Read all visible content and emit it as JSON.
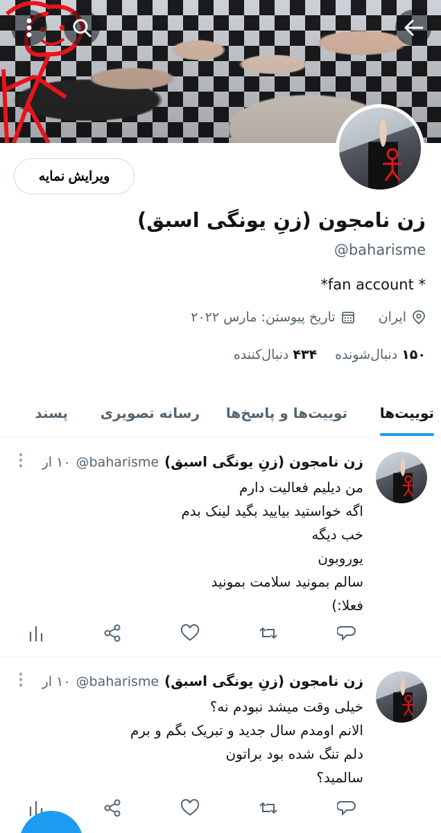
{
  "profile": {
    "name": "زن نامجون (زنِ یونگی اسبق)",
    "handle": "@baharisme",
    "bio": "*fan account *",
    "location": "ایران",
    "joined": "تاریخ پیوستن: مارس ۲۰۲۲",
    "following_count": "۱۵۰",
    "following_label": "دنبال‌شونده",
    "followers_count": "۴۳۴",
    "followers_label": "دنبال‌کننده",
    "edit_label": "ویرایش نمایه"
  },
  "banner": {
    "back_icon": "arrow-left-icon",
    "search_icon": "search-icon",
    "more_icon": "more-vertical-icon"
  },
  "tabs": [
    {
      "label": "توییت‌ها",
      "active": true
    },
    {
      "label": "توییت‌ها و پاسخ‌ها",
      "active": false
    },
    {
      "label": "رسانه تصویری",
      "active": false
    },
    {
      "label": "پسند",
      "active": false
    }
  ],
  "tweets": [
    {
      "name": "زن نامجون (زنِ یونگی اسبق)",
      "handle": "@baharisme",
      "time": "۱۰ ار",
      "lines": [
        "من دیلیم فعالیت دارم",
        "اگه خواستید بیایید بگید لینک بدم",
        "خب دیگه",
        "یوروبون",
        "سالم بمونید سلامت بمونید",
        "فعلا:)"
      ]
    },
    {
      "name": "زن نامجون (زنِ یونگی اسبق)",
      "handle": "@baharisme",
      "time": "۱۰ ار",
      "lines": [
        "خیلی وقت میشد نبودم نه؟",
        "الانم اومدم سال جدید و تبریک بگم و برم",
        "دلم تنگ شده بود براتون",
        "سالمید؟"
      ]
    }
  ],
  "colors": {
    "accent": "#1d9bf0",
    "text": "#0f1419",
    "muted": "#536471"
  }
}
